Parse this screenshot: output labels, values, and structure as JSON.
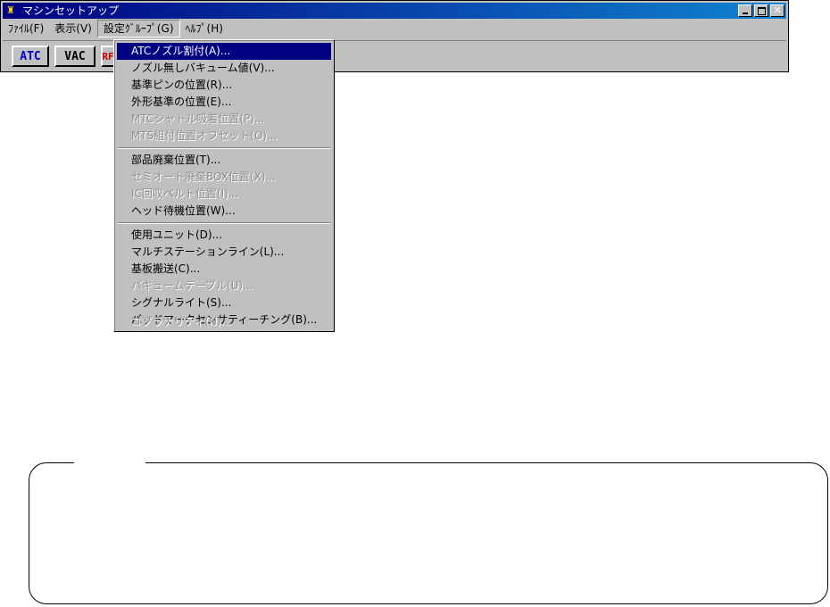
{
  "window": {
    "title": "マシンセットアップ",
    "icon": "tools-icon",
    "controls": {
      "minimize": "minimize-icon",
      "maximize": "maximize-icon",
      "close": "close-icon"
    }
  },
  "menubar": {
    "items": [
      {
        "label": "ﾌｧｲﾙ(F)"
      },
      {
        "label": "表示(V)"
      },
      {
        "label": "設定ｸﾞﾙｰﾌﾟ(G)"
      },
      {
        "label": "ﾍﾙﾌﾟ(H)"
      }
    ]
  },
  "toolbar": {
    "buttons": [
      {
        "label": "ATC"
      },
      {
        "label": "VAC"
      },
      {
        "label": "RF"
      }
    ]
  },
  "dropdown": {
    "items": [
      {
        "label": "ATCノズル割付(A)...",
        "highlighted": true
      },
      {
        "label": "ノズル無しバキューム値(V)..."
      },
      {
        "label": "基準ピンの位置(R)..."
      },
      {
        "label": "外形基準の位置(E)..."
      },
      {
        "label": "MTCシャトル吸着位置(P)...",
        "disabled": true
      },
      {
        "label": "MTS組付位置オフセット(O)...",
        "disabled": true
      },
      {
        "label": "部品廃棄位置(T)..."
      },
      {
        "label": "セミオート廃棄BOX位置(X)...",
        "disabled": true
      },
      {
        "label": "IC回収ベルト位置(I)...",
        "disabled": true
      },
      {
        "label": "ヘッド待機位置(W)..."
      },
      {
        "label": "使用ユニット(D)..."
      },
      {
        "label": "マルチステーションライン(L)..."
      },
      {
        "label": "基板搬送(C)..."
      },
      {
        "label": "バキュームテーブル(U)...",
        "disabled": true
      },
      {
        "label": "シグナルライト(S)..."
      },
      {
        "label": "バッドマークセンサティーチング(B)..."
      },
      {
        "label": "コプラナリティ(N)...",
        "disabled": true
      }
    ]
  }
}
